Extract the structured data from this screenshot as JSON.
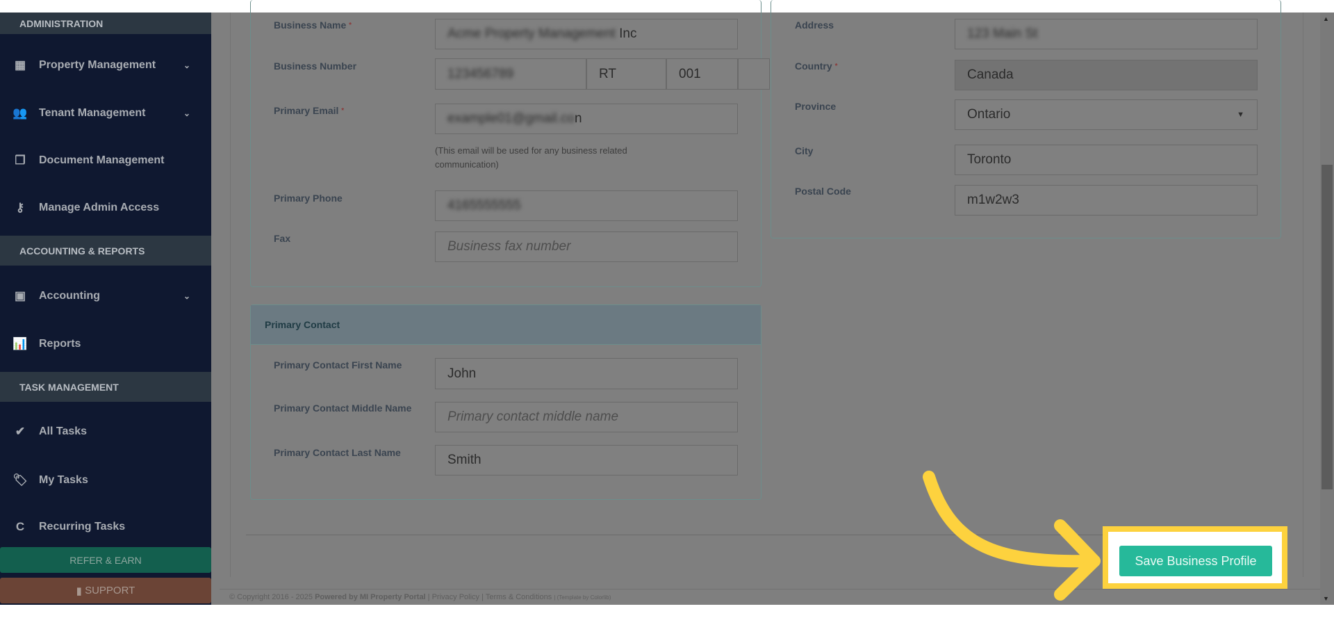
{
  "sidebar": {
    "sections": [
      "ADMINISTRATION",
      "ACCOUNTING & REPORTS",
      "TASK MANAGEMENT"
    ],
    "items": [
      {
        "label": "Property Management",
        "icon": "building-icon"
      },
      {
        "label": "Tenant Management",
        "icon": "users-icon"
      },
      {
        "label": "Document Management",
        "icon": "documents-icon"
      },
      {
        "label": "Manage Admin Access",
        "icon": "key-icon"
      },
      {
        "label": "Accounting",
        "icon": "money-icon"
      },
      {
        "label": "Reports",
        "icon": "bar-chart-icon"
      },
      {
        "label": "All Tasks",
        "icon": "check-icon"
      },
      {
        "label": "My Tasks",
        "icon": "tag-icon"
      },
      {
        "label": "Recurring Tasks",
        "icon": "refresh-icon"
      }
    ],
    "refer": "REFER & EARN",
    "support": "SUPPORT"
  },
  "business": {
    "name_label": "Business Name",
    "name_blur": "Acme Property Management",
    "name_clear": " Inc",
    "number_label": "Business Number",
    "number_value": "123456789",
    "number_rt": "RT",
    "number_suffix": "001",
    "email_label": "Primary Email",
    "email_blur": "example01@gmail.co",
    "email_clear": "n",
    "email_help": "(This email will be used for any business related communication)",
    "phone_label": "Primary Phone",
    "phone_value": "4165555555",
    "fax_label": "Fax",
    "fax_placeholder": "Business fax number"
  },
  "address": {
    "address_label": "Address",
    "address_value": "123 Main St",
    "country_label": "Country",
    "country_value": "Canada",
    "province_label": "Province",
    "province_value": "Ontario",
    "city_label": "City",
    "city_value": "Toronto",
    "postal_label": "Postal Code",
    "postal_value": "m1w2w3"
  },
  "contact": {
    "title": "Primary Contact",
    "first_label": "Primary Contact First Name",
    "first_value": "John",
    "middle_label": "Primary Contact Middle Name",
    "middle_placeholder": "Primary contact middle name",
    "last_label": "Primary Contact Last Name",
    "last_value": "Smith"
  },
  "save_label": "Save Business Profile",
  "footer": {
    "copyright": "© Copyright 2016 - 2025 ",
    "powered": "Powered by MI Property Portal",
    "links": " | Privacy Policy | Terms & Conditions ",
    "template": "| (Template by Colorlib)"
  },
  "colors": {
    "accent": "#26b99a",
    "highlight": "#fdd23e"
  }
}
